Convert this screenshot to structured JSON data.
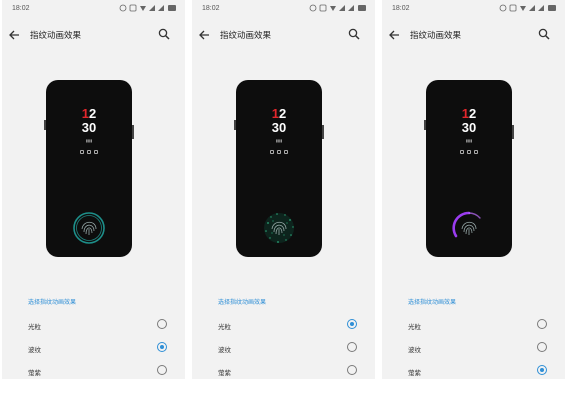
{
  "accent_color": "#2f8fd6",
  "screens": [
    {
      "status_time": "18:02",
      "title": "指纹动画效果",
      "lock": {
        "clock_hour_red": "1",
        "clock_hour_rest": "2",
        "clock_minutes": "30"
      },
      "fingerprint_effect": "ring-cyan",
      "section_label": "选择指纹动画效果",
      "options": [
        {
          "label": "光粒",
          "selected": false
        },
        {
          "label": "波纹",
          "selected": true
        },
        {
          "label": "萤紫",
          "selected": false
        }
      ]
    },
    {
      "status_time": "18:02",
      "title": "指纹动画效果",
      "lock": {
        "clock_hour_red": "1",
        "clock_hour_rest": "2",
        "clock_minutes": "30"
      },
      "fingerprint_effect": "particles-green",
      "section_label": "选择指纹动画效果",
      "options": [
        {
          "label": "光粒",
          "selected": true
        },
        {
          "label": "波纹",
          "selected": false
        },
        {
          "label": "萤紫",
          "selected": false
        }
      ]
    },
    {
      "status_time": "18:02",
      "title": "指纹动画效果",
      "lock": {
        "clock_hour_red": "1",
        "clock_hour_rest": "2",
        "clock_minutes": "30"
      },
      "fingerprint_effect": "arc-purple",
      "section_label": "选择指纹动画效果",
      "options": [
        {
          "label": "光粒",
          "selected": false
        },
        {
          "label": "波纹",
          "selected": false
        },
        {
          "label": "萤紫",
          "selected": true
        }
      ]
    }
  ]
}
